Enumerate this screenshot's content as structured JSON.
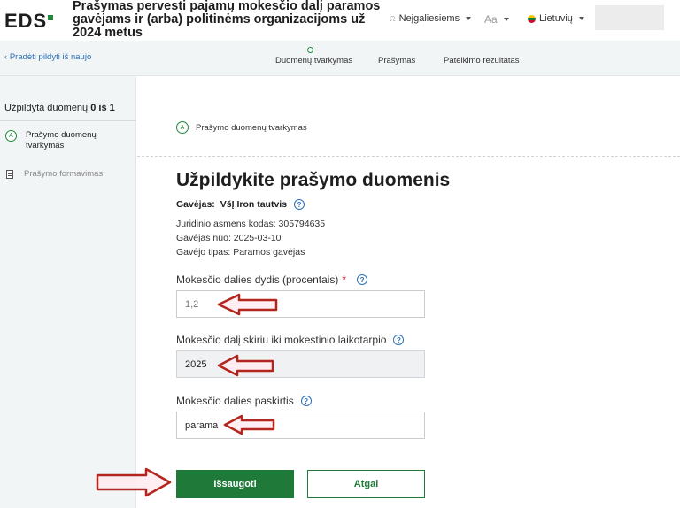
{
  "header": {
    "logo_text": "EDS",
    "title": "Prašymas pervesti pajamų mokesčio dalį paramos gavėjams ir (arba) politinėms organizacijoms už 2024 metus",
    "accessibility_label": "Neįgaliesiems",
    "font_size_label": "Aa",
    "language_label": "Lietuvių",
    "icons": {
      "accessibility": "accessibility-icon",
      "language": "lithuania-flag-icon"
    }
  },
  "subbar": {
    "restart_link": "Pradėti pildyti iš naujo",
    "steps": [
      "Duomenų tvarkymas",
      "Prašymas",
      "Pateikimo rezultatas"
    ]
  },
  "sidebar": {
    "progress_label": "Užpildyta duomenų",
    "progress_value": "0 iš 1",
    "items": [
      {
        "badge": "A",
        "label": "Prašymo duomenų tvarkymas"
      },
      {
        "label": "Prašymo formavimas"
      }
    ]
  },
  "main": {
    "section_badge": "A",
    "section_label": "Prašymo duomenų tvarkymas",
    "heading": "Užpildykite prašymo duomenis",
    "recipient_label": "Gavėjas:",
    "recipient_name": "VšĮ Iron tautvis",
    "info_lines": [
      "Juridinio asmens kodas: 305794635",
      "Gavėjas nuo: 2025-03-10",
      "Gavėjo tipas: Paramos gavėjas"
    ],
    "fields": [
      {
        "label": "Mokesčio dalies dydis (procentais)",
        "required_mark": "*",
        "value": "1,2"
      },
      {
        "label": "Mokesčio dalį skiriu iki mokestinio laikotarpio",
        "value": "2025"
      },
      {
        "label": "Mokesčio dalies paskirtis",
        "value": "parama"
      }
    ],
    "save_button": "Išsaugoti",
    "back_button": "Atgal"
  },
  "colors": {
    "primary_green": "#1f7a3a",
    "link_blue": "#2a6fb5",
    "annotation_red": "#b3261e"
  }
}
